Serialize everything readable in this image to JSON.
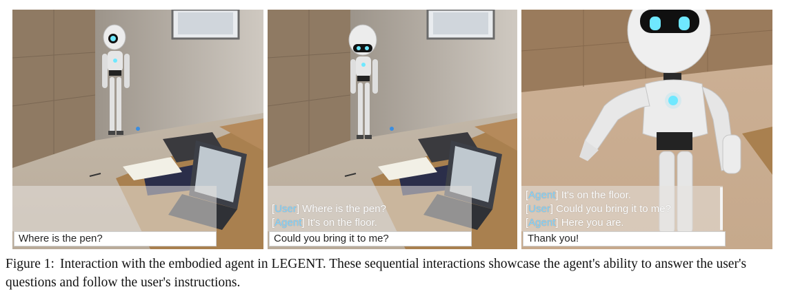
{
  "panels": [
    {
      "chat_lines": [],
      "input_text": "Where is the pen?"
    },
    {
      "chat_lines": [
        {
          "speaker": "User",
          "text": " Where is the pen?"
        },
        {
          "speaker": "Agent",
          "text": " It's on the floor."
        }
      ],
      "input_text": "Could you bring it to me?"
    },
    {
      "chat_lines": [
        {
          "speaker": "Agent",
          "text": " It's on the floor."
        },
        {
          "speaker": "User",
          "text": " Could you bring it to me?"
        },
        {
          "speaker": "Agent",
          "text": " Here you are."
        }
      ],
      "input_text": "Thank you!"
    }
  ],
  "caption": {
    "label": "Figure 1:",
    "text": "Interaction with the embodied agent in LEGENT. These sequential interactions showcase the agent's ability to answer the user's questions and follow the user's instructions."
  },
  "colors": {
    "speaker_tag": "#7fd3ff",
    "robot_eye": "#6fe8ff"
  }
}
